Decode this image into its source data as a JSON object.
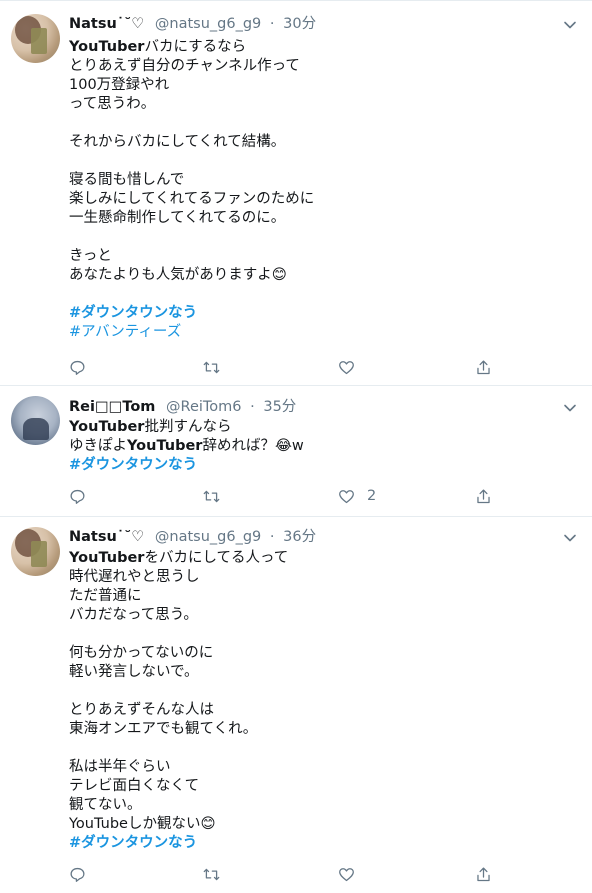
{
  "tweets": [
    {
      "name": "Natsu",
      "name_suffix": "˙˘♡",
      "handle": "@natsu_g6_g9",
      "separator": "·",
      "time": "30分",
      "lines": [
        "YouTuberバカにするなら",
        "とりあえず自分のチャンネル作って",
        "100万登録やれ",
        "って思うわ。",
        "",
        "それからバカにしてくれて結構。",
        "",
        "寝る間も惜しんで",
        "楽しみにしてくれてるファンのために",
        "一生懸命制作してくれてるのに。",
        "",
        "きっと",
        "あなたよりも人気がありますよ😊",
        ""
      ],
      "hashtags": [
        "#ダウンタウンなう",
        "#アバンティーズ"
      ],
      "like_count": ""
    },
    {
      "name": "Rei□□Tom",
      "name_suffix": "",
      "handle": "@ReiTom6",
      "separator": "·",
      "time": "35分",
      "lines": [
        "YouTuber批判すんなら",
        "ゆきぽよYouTuber辞めれば？😂w"
      ],
      "hashtags": [
        "#ダウンタウンなう"
      ],
      "like_count": "2"
    },
    {
      "name": "Natsu",
      "name_suffix": "˙˘♡",
      "handle": "@natsu_g6_g9",
      "separator": "·",
      "time": "36分",
      "lines": [
        "YouTuberをバカにしてる人って",
        "時代遅れやと思うし",
        "ただ普通に",
        "バカだなって思う。",
        "",
        "何も分かってないのに",
        "軽い発言しないで。",
        "",
        "とりあえずそんな人は",
        "東海オンエアでも観てくれ。",
        "",
        "私は半年ぐらい",
        "テレビ面白くなくて",
        "観てない。",
        "YouTubeしか観ない😊"
      ],
      "hashtags": [
        "#ダウンタウンなう"
      ],
      "like_count": ""
    }
  ],
  "icons": {
    "reply": "reply-icon",
    "retweet": "retweet-icon",
    "like": "heart-icon",
    "share": "share-icon",
    "menu": "chevron-down-icon"
  },
  "colors": {
    "link": "#1b95e0",
    "secondary": "#657786",
    "border": "#e6ecf0"
  }
}
